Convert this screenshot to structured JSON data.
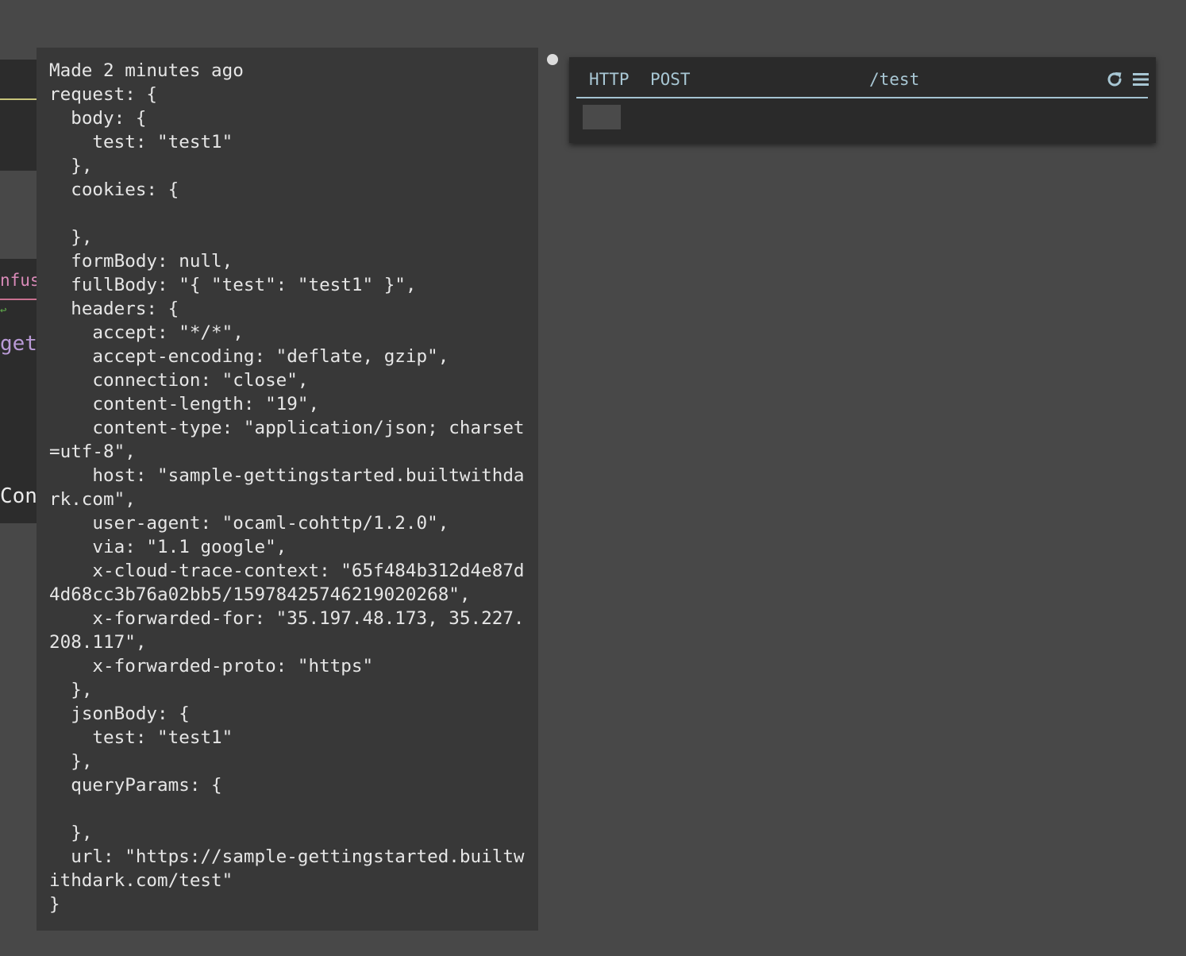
{
  "background_fragments": {
    "pink_text": "nfus",
    "green_glyph": "↩",
    "purple_text": "gett",
    "white_text": "Cont"
  },
  "trace": {
    "text": "Made 2 minutes ago\nrequest: {\n  body: {\n    test: \"test1\"\n  },\n  cookies: {\n\n  },\n  formBody: null,\n  fullBody: \"{ \"test\": \"test1\" }\",\n  headers: {\n    accept: \"*/*\",\n    accept-encoding: \"deflate, gzip\",\n    connection: \"close\",\n    content-length: \"19\",\n    content-type: \"application/json; charset=utf-8\",\n    host: \"sample-gettingstarted.builtwithdark.com\",\n    user-agent: \"ocaml-cohttp/1.2.0\",\n    via: \"1.1 google\",\n    x-cloud-trace-context: \"65f484b312d4e87d4d68cc3b76a02bb5/15978425746219020268\",\n    x-forwarded-for: \"35.197.48.173, 35.227.208.117\",\n    x-forwarded-proto: \"https\"\n  },\n  jsonBody: {\n    test: \"test1\"\n  },\n  queryParams: {\n\n  },\n  url: \"https://sample-gettingstarted.builtwithdark.com/test\"\n}"
  },
  "handler": {
    "type": "HTTP",
    "method": "POST",
    "path": "/test",
    "icons": [
      "refresh-icon",
      "hamburger-menu-icon"
    ]
  },
  "colors": {
    "canvas": "#484848",
    "panel": "#383838",
    "handler_bg": "#2a2a2a",
    "accent": "#a8c7d4"
  }
}
